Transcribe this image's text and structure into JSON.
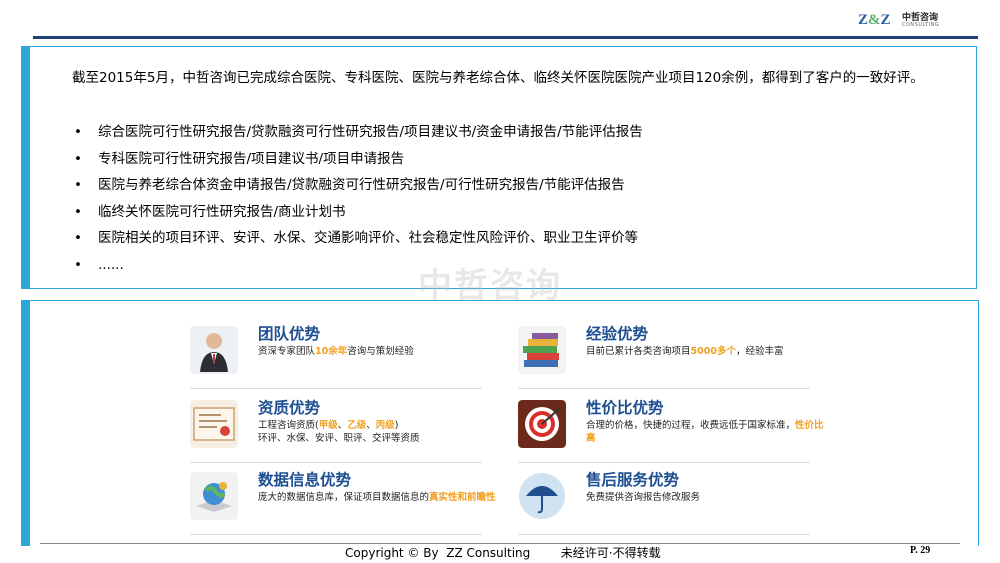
{
  "logo": {
    "mark_a": "Z",
    "mark_amp": "&",
    "mark_b": "Z",
    "name_cn": "中哲咨询",
    "name_en": "CONSULTING"
  },
  "intro": "截至2015年5月，中哲咨询已完成综合医院、专科医院、医院与养老综合体、临终关怀医院医院产业项目120余例，都得到了客户的一致好评。",
  "bullets": [
    "综合医院可行性研究报告/贷款融资可行性研究报告/项目建议书/资金申请报告/节能评估报告",
    "专科医院可行性研究报告/项目建议书/项目申请报告",
    "医院与养老综合体资金申请报告/贷款融资可行性研究报告/可行性研究报告/节能评估报告",
    "临终关怀医院可行性研究报告/商业计划书",
    "医院相关的项目环评、安评、水保、交通影响评价、社会稳定性风险评价、职业卫生评价等",
    "......"
  ],
  "watermark": "中哲咨询",
  "advantages": {
    "team": {
      "title": "团队优势",
      "desc_a": "资深专家团队",
      "desc_hl": "10余年",
      "desc_b": "咨询与策划经验",
      "icon": "team-person-icon"
    },
    "experience": {
      "title": "经验优势",
      "desc_a": "目前已累计各类咨询项目",
      "desc_hl": "5000多个",
      "desc_b": "，经验丰富",
      "icon": "books-stack-icon"
    },
    "qualification": {
      "title": "资质优势",
      "line1_a": "工程咨询资质(",
      "grade1": "甲级",
      "sep1": "、",
      "grade2": "乙级",
      "sep2": "、",
      "grade3": "丙级",
      "line1_b": ")",
      "line2": "环评、水保、安评、职评、交评等资质",
      "icon": "certificate-icon"
    },
    "value": {
      "title": "性价比优势",
      "line1": "合理的价格，快捷的过程，收费远低于国家标准",
      "line2_a": "，",
      "line2_hl": "性价比高",
      "icon": "target-icon"
    },
    "data": {
      "title": "数据信息优势",
      "desc_a": "庞大的数据信息库，保证项目数据信息的",
      "desc_hl": "真实性和前瞻性",
      "icon": "data-globe-icon"
    },
    "service": {
      "title": "售后服务优势",
      "desc": "免费提供咨询报告修改服务",
      "icon": "umbrella-icon"
    }
  },
  "footer": {
    "copyright": "Copyright © By  ZZ Consulting        未经许可·不得转载",
    "page": "P. 29"
  },
  "colors": {
    "accent": "#2aa7d8",
    "title_blue": "#1d4f91",
    "highlight": "#f0a020",
    "rule": "#1f3f78"
  }
}
